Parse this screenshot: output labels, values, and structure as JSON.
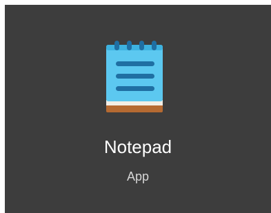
{
  "tile": {
    "app_name": "Notepad",
    "app_kind": "App",
    "icon": "notepad-icon"
  },
  "colors": {
    "tile_background": "#3d3d3d",
    "notepad_blue": "#5cc8f0",
    "notepad_lines": "#1f6fa3",
    "notepad_footer": "#b56a32"
  }
}
